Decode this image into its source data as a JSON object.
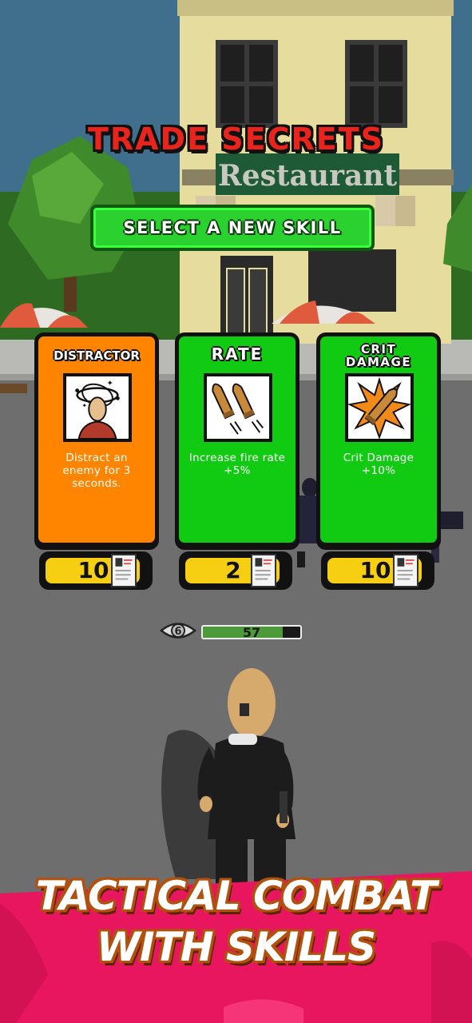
{
  "screen": {
    "title": "TRADE SECRETS",
    "prompt": "SELECT A NEW SKILL",
    "building_sign": "Restaurant"
  },
  "skills": [
    {
      "name_line1": "DISTRACTOR",
      "name_line2": "",
      "icon": "distracted-head-icon",
      "description_line1": "Distract an",
      "description_line2": "enemy for 3",
      "description_line3": "seconds.",
      "cost": "10",
      "color": "#ff8500"
    },
    {
      "name_line1": "RATE",
      "name_line2": "",
      "icon": "bullets-icon",
      "description_line1": "Increase fire rate",
      "description_line2": "+5%",
      "description_line3": "",
      "cost": "2",
      "color": "#10cb12"
    },
    {
      "name_line1": "CRIT",
      "name_line2": "DAMAGE",
      "icon": "bullet-impact-icon",
      "description_line1": "Crit Damage",
      "description_line2": "+10%",
      "description_line3": "",
      "cost": "10",
      "color": "#10cb12"
    }
  ],
  "hud": {
    "vision_level": "6",
    "health": "57",
    "health_fraction": 0.82
  },
  "promo": {
    "line1": "TACTICAL COMBAT",
    "line2": "WITH SKILLS",
    "accent": "#e8165e"
  },
  "colors": {
    "title_red": "#e8241c",
    "button_green": "#2bd12e",
    "cost_yellow": "#f7cf12"
  }
}
